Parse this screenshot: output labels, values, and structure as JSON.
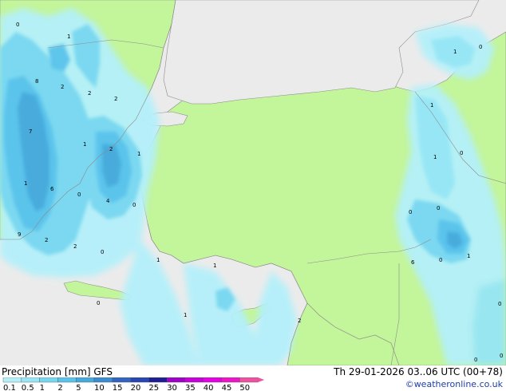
{
  "footer": {
    "title": "Precipitation [mm] GFS",
    "valid_time": "Th 29-01-2026 03..06 UTC (00+78)",
    "credit": "©weatheronline.co.uk"
  },
  "legend": {
    "labels": [
      "0.1",
      "0.5",
      "1",
      "2",
      "5",
      "10",
      "15",
      "20",
      "25",
      "30",
      "35",
      "40",
      "45",
      "50"
    ],
    "colors": [
      "#b4f0fa",
      "#96e6f5",
      "#78d7f0",
      "#5ac3eb",
      "#46aadc",
      "#3c8cd2",
      "#3264c3",
      "#2846b4",
      "#1e1e96",
      "#a000c8",
      "#c800dc",
      "#e600e6",
      "#f014c8",
      "#f050a0"
    ]
  },
  "colors": {
    "land": "#c3f59a",
    "sea": "#ebebeb",
    "border": "#8c8c8c"
  },
  "map_labels": [
    {
      "text": "0"
    },
    {
      "text": "1"
    },
    {
      "text": "8"
    },
    {
      "text": "2"
    },
    {
      "text": "2"
    },
    {
      "text": "2"
    },
    {
      "text": "7"
    },
    {
      "text": "1"
    },
    {
      "text": "1"
    },
    {
      "text": "2"
    },
    {
      "text": "1"
    },
    {
      "text": "6"
    },
    {
      "text": "0"
    },
    {
      "text": "4"
    },
    {
      "text": "0"
    },
    {
      "text": "9"
    },
    {
      "text": "2"
    },
    {
      "text": "2"
    },
    {
      "text": "0"
    },
    {
      "text": "1"
    },
    {
      "text": "1"
    },
    {
      "text": "0"
    },
    {
      "text": "1"
    },
    {
      "text": "2"
    },
    {
      "text": "1"
    },
    {
      "text": "0"
    },
    {
      "text": "1"
    },
    {
      "text": "1"
    },
    {
      "text": "0"
    },
    {
      "text": "0"
    },
    {
      "text": "0"
    },
    {
      "text": "6"
    },
    {
      "text": "0"
    },
    {
      "text": "1"
    },
    {
      "text": "0"
    },
    {
      "text": "0"
    },
    {
      "text": "0"
    }
  ]
}
